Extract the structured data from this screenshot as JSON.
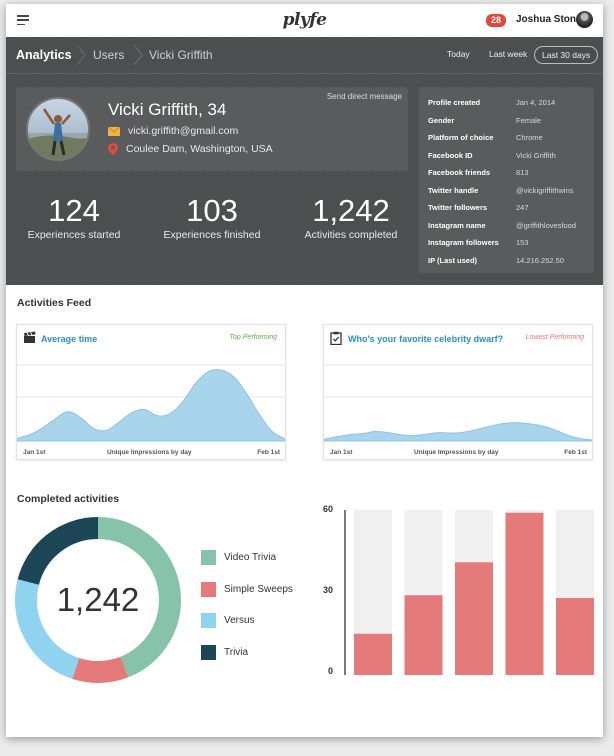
{
  "topbar": {
    "logo": "plyfe",
    "notifications": "28",
    "user_name": "Joshua Stone"
  },
  "breadcrumb": [
    "Analytics",
    "Users",
    "Vicki Griffith"
  ],
  "date_ranges": [
    "Today",
    "Last week",
    "Last 30 days"
  ],
  "profile": {
    "send_dm": "Send direct message",
    "name": "Vicki Griffith, 34",
    "email": "vicki.griffith@gmail.com",
    "location": "Coulee Dam, Washington, USA"
  },
  "stats": [
    {
      "value": "124",
      "label": "Experiences started"
    },
    {
      "value": "103",
      "label": "Experiences finished"
    },
    {
      "value": "1,242",
      "label": "Activities completed"
    }
  ],
  "info": [
    {
      "k": "Profile created",
      "v": "Jan 4, 2014"
    },
    {
      "k": "Gender",
      "v": "Female"
    },
    {
      "k": "Platform of choice",
      "v": "Chrome"
    },
    {
      "k": "Facebook ID",
      "v": "Vicki Griffith"
    },
    {
      "k": "Facebook friends",
      "v": "813"
    },
    {
      "k": "Twitter handle",
      "v": "@vickigriffithwins"
    },
    {
      "k": "Twitter followers",
      "v": "247"
    },
    {
      "k": "Instagram name",
      "v": "@griffithlovesfood"
    },
    {
      "k": "Instagram followers",
      "v": "153"
    },
    {
      "k": "IP (Last used)",
      "v": "14.216.252.50"
    }
  ],
  "feed": {
    "title": "Activities Feed",
    "cards": [
      {
        "title": "Average time",
        "perf": "Top Performing",
        "x_start": "Jan 1st",
        "x_mid": "Unique Impressions by day",
        "x_end": "Feb 1st"
      },
      {
        "title": "Who's your favorite celebrity dwarf?",
        "perf": "Lowest Performing",
        "x_start": "Jan 1st",
        "x_mid": "Unique Impressions by day",
        "x_end": "Feb 1st"
      }
    ]
  },
  "completed": {
    "title": "Completed activities",
    "total": "1,242"
  },
  "colors": {
    "accent_blue": "#2f8fc9",
    "area_fill": "#a9d5ec",
    "video_trivia": "#86c3a9",
    "simple_sweeps": "#e57a7a",
    "versus": "#8fd3f0",
    "trivia": "#1c4556",
    "bar": "#e57a7a",
    "bar_bg": "#f0f0f0",
    "badge": "#e2483d"
  },
  "chart_data": [
    {
      "type": "area",
      "title": "Average time",
      "xlabel": "Unique Impressions by day",
      "x_range": [
        "Jan 1st",
        "Feb 1st"
      ],
      "values": [
        0.5,
        1.2,
        2.5,
        4.2,
        5.6,
        4.4,
        2.4,
        2.0,
        3.6,
        5.4,
        6.0,
        4.8,
        5.2,
        7.5,
        11.0,
        13.2,
        13.5,
        12.2,
        9.0,
        5.0,
        1.8,
        0.4
      ],
      "ylim": [
        0,
        16
      ]
    },
    {
      "type": "area",
      "title": "Who's your favorite celebrity dwarf?",
      "xlabel": "Unique Impressions by day",
      "x_range": [
        "Jan 1st",
        "Feb 1st"
      ],
      "values": [
        0.3,
        0.8,
        1.2,
        1.4,
        1.8,
        1.6,
        1.2,
        1.0,
        1.3,
        1.6,
        1.5,
        1.7,
        2.2,
        2.8,
        3.3,
        3.5,
        3.3,
        2.9,
        2.2,
        1.2,
        0.5,
        0.2
      ],
      "ylim": [
        0,
        16
      ]
    },
    {
      "type": "pie",
      "donut": true,
      "center_label": "1,242",
      "slices": [
        {
          "name": "Video Trivia",
          "value": 44
        },
        {
          "name": "Simple Sweeps",
          "value": 11
        },
        {
          "name": "Versus",
          "value": 24
        },
        {
          "name": "Trivia",
          "value": 21
        }
      ]
    },
    {
      "type": "bar",
      "categories": [
        "",
        "",
        "",
        "",
        ""
      ],
      "values": [
        15,
        29,
        41,
        59,
        28
      ],
      "ylim": [
        0,
        60
      ],
      "yticks": [
        "0",
        "30",
        "60"
      ],
      "grid": false
    }
  ]
}
